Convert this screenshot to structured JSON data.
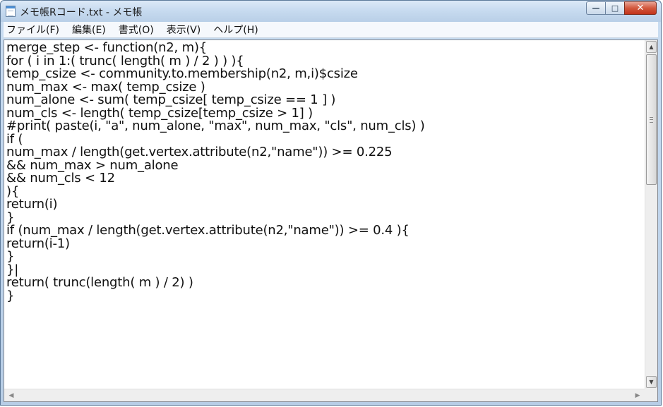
{
  "window": {
    "title": "メモ帳Rコード.txt - メモ帳",
    "app_icon": "notepad-icon",
    "caption_buttons": {
      "minimize": "—",
      "maximize": "□",
      "close": "✕"
    }
  },
  "menu": [
    {
      "label": "ファイル(F)"
    },
    {
      "label": "編集(E)"
    },
    {
      "label": "書式(O)"
    },
    {
      "label": "表示(V)"
    },
    {
      "label": "ヘルプ(H)"
    }
  ],
  "editor": {
    "lines": [
      "merge_step <- function(n2, m){",
      "for ( i in 1:( trunc( length( m ) / 2 ) ) ){",
      "temp_csize <- community.to.membership(n2, m,i)$csize",
      "num_max <- max( temp_csize )",
      "num_alone <- sum( temp_csize[ temp_csize == 1 ] )",
      "num_cls <- length( temp_csize[temp_csize > 1] )",
      "#print( paste(i, \"a\", num_alone, \"max\", num_max, \"cls\", num_cls) )",
      "if (",
      "num_max / length(get.vertex.attribute(n2,\"name\")) >= 0.225",
      "&& num_max > num_alone",
      "&& num_cls < 12",
      "){",
      "return(i)",
      "}",
      "if (num_max / length(get.vertex.attribute(n2,\"name\")) >= 0.4 ){",
      "return(i-1)",
      "}",
      "}|",
      "return( trunc(length( m ) / 2) )",
      "}"
    ]
  },
  "scrollbar": {
    "up_arrow": "▲",
    "down_arrow": "▼",
    "left_arrow": "◀",
    "right_arrow": "▶"
  },
  "colors": {
    "close_button": "#c2341b",
    "text": "#111111",
    "titlebar": "#c6daef"
  }
}
